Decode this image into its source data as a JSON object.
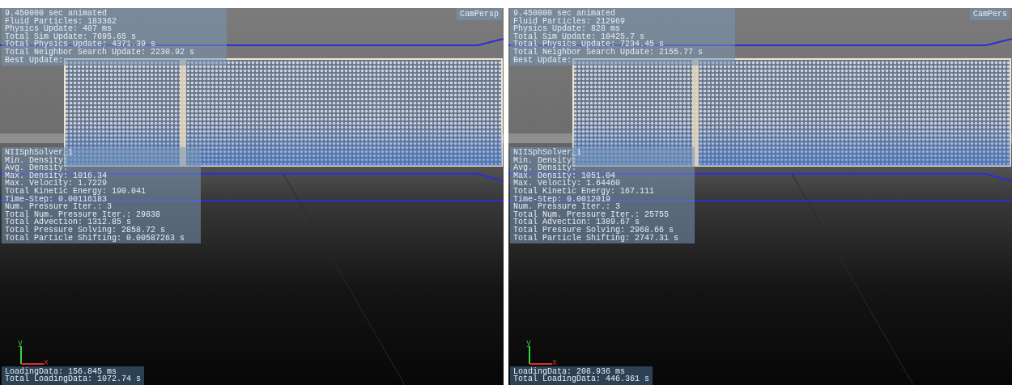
{
  "viewports": [
    {
      "camera": "CamPersp",
      "stats": [
        "9.450000 sec animated",
        "Fluid Particles: 183362",
        "Physics Update: 407 ms",
        "Total Sim Update: 7695.65 s",
        "Total Physics Update: 4371.39 s",
        "Total Neighbor Search Update: 2230.92 s",
        "Best Update:"
      ],
      "solver": [
        "NIISphSolver_1",
        "Min. Density:",
        "Avg. Density:",
        "Max. Density: 1016.34",
        "Max. Velocity: 1.7229",
        "Total Kinetic Energy: 190.041",
        "Time-Step: 0.00116183",
        "Num. Pressure Iter.: 3",
        "Total Num. Pressure Iter.: 29838",
        "Total Advection: 1312.85 s",
        "Total Pressure Solving: 2858.72 s",
        "Total Particle Shifting: 0.00587263 s"
      ],
      "axis_labels": [
        "y",
        "x"
      ],
      "loading": [
        "LoadingData: 156.845 ms",
        "Total LoadingData: 1072.74 s"
      ]
    },
    {
      "camera": "CamPers",
      "stats": [
        "9.450000 sec animated",
        "Fluid Particles: 212969",
        "Physics Update: 828 ms",
        "Total Sim Update: 10425.7 s",
        "Total Physics Update: 7234.45 s",
        "Total Neighbor Search Update: 2155.77 s",
        "Best Update:"
      ],
      "solver": [
        "NIISphSolver_1",
        "Min. Density:",
        "Avg. Density:",
        "Max. Density: 1051.04",
        "Max. Velocity: 1.64460",
        "Total Kinetic Energy: 167.111",
        "Time-Step: 0.0012019",
        "Num. Pressure Iter.: 3",
        "Total Num. Pressure Iter.: 25755",
        "Total Advection: 1389.67 s",
        "Total Pressure Solving: 2968.66 s",
        "Total Particle Shifting: 2747.31 s"
      ],
      "axis_labels": [
        "y",
        "x"
      ],
      "loading": [
        "LoadingData: 208.936 ms",
        "Total LoadingData: 446.361 s"
      ]
    }
  ]
}
